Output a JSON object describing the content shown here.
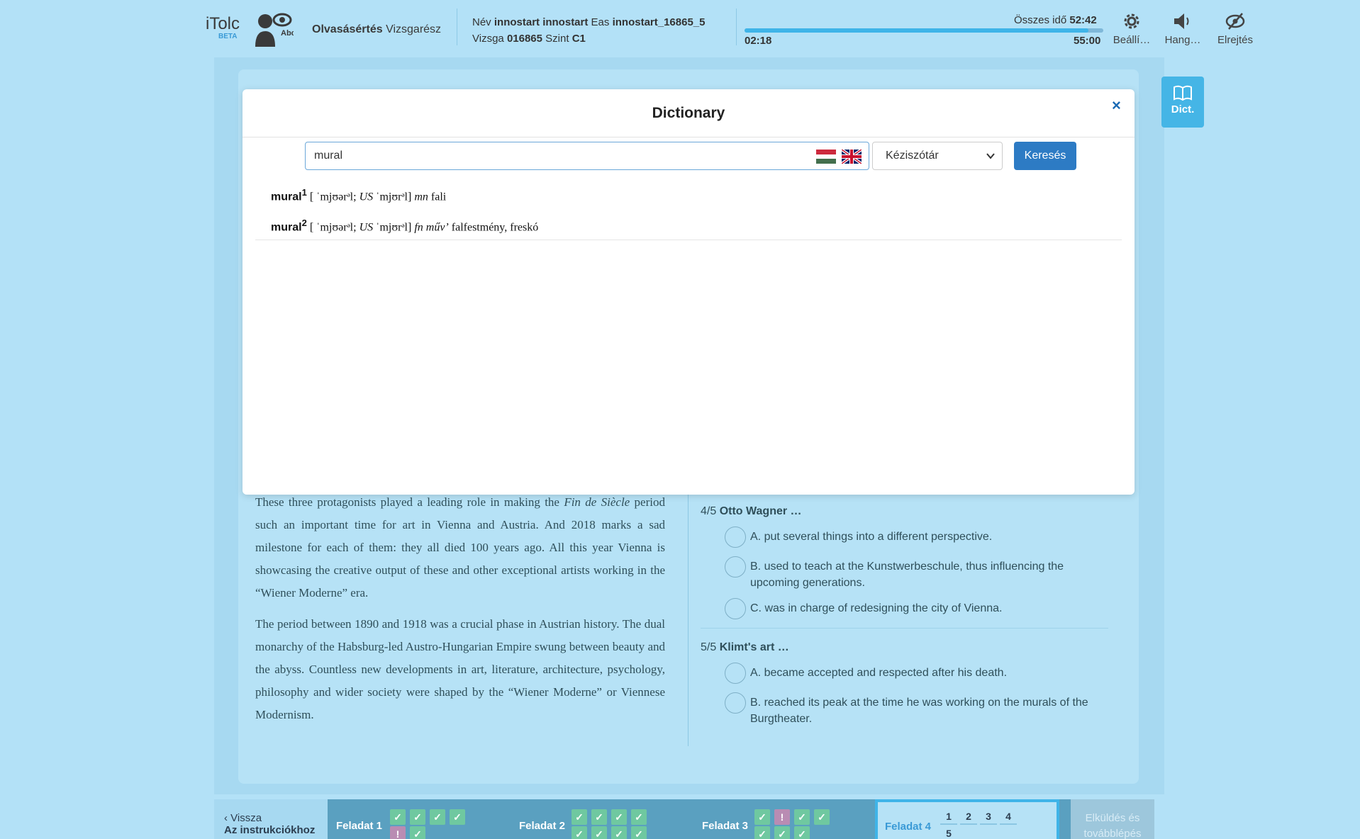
{
  "header": {
    "logo": "iTolc",
    "beta": "BETA",
    "mode_bold": "Olvasásértés",
    "mode_rest": "Vizsgarész",
    "name_label": "Név",
    "name_value": "innostart innostart",
    "eas_label": "Eas",
    "eas_value": "innostart_16865_5",
    "exam_label": "Vizsga",
    "exam_value": "016865",
    "level_label": "Szint",
    "level_value": "C1",
    "total_label": "Összes idő",
    "total_value": "52:42",
    "elapsed": "02:18",
    "remaining": "55:00",
    "progress_fraction": 0.958,
    "settings_label": "Beállí…",
    "sound_label": "Hang…",
    "hide_label": "Elrejtés"
  },
  "sidebar": {
    "dict_label": "Dict."
  },
  "modal": {
    "title": "Dictionary",
    "close": "×",
    "search_value": "mural",
    "dictionary_select": "Kéziszótár",
    "search_button": "Keresés",
    "entries": [
      {
        "headword": "mural",
        "sup": "1",
        "pron": " [ ˈmjʊərᵊl; ",
        "us": "US",
        "pron_us": " ˈmjʊrᵊl] ",
        "pos": "mn",
        "meaning": " fali"
      },
      {
        "headword": "mural",
        "sup": "2",
        "pron": " [ ˈmjʊərᵊl; ",
        "us": "US",
        "pron_us": " ˈmjʊrᵊl] ",
        "pos": "fn művʼ",
        "meaning": " falfestmény, freskó"
      }
    ]
  },
  "passage": {
    "p1_a": "These three protagonists played a leading role in making the ",
    "p1_em": "Fin de Siècle",
    "p1_b": " period such an important time for art in Vienna and Austria. And 2018 marks a sad milestone for each of them: they all died 100 years ago. All this year Vienna is showcasing the creative output of these and other exceptional artists working in the “Wiener Moderne” era.",
    "p2": "The period between 1890 and 1918 was a crucial phase in Austrian history. The dual monarchy of the Habsburg-led Austro-Hungarian Empire swung between beauty and the abyss. Countless new developments in art, literature, architecture, psychology, philosophy and wider society were shaped by the “Wiener Moderne” or Viennese Modernism."
  },
  "questions": [
    {
      "num": "4/5",
      "title": "Otto Wagner …",
      "options": [
        "A. put several things into a different perspective.",
        "B. used to teach at the Kunstwerbeschule, thus influencing the upcoming generations.",
        "C. was in charge of redesigning the city of Vienna."
      ]
    },
    {
      "num": "5/5",
      "title": "Klimt's art …",
      "options": [
        "A. became accepted and respected after his death.",
        "B. reached its peak at the time he was working on the murals of the Burgtheater."
      ]
    }
  ],
  "bottom": {
    "back_line1": "Vissza",
    "back_line2": "Az instrukciókhoz",
    "task1": "Feladat 1",
    "task2": "Feladat 2",
    "task3": "Feladat 3",
    "task4": "Feladat 4",
    "check": "✓",
    "warn": "!",
    "task4_numbers": [
      "1",
      "2",
      "3",
      "4",
      "5"
    ],
    "submit": "Elküldés és továbblépés"
  },
  "colors": {
    "background": "#b3e1f7",
    "accent": "#2d7bc4",
    "check": "#6fc8a0",
    "warn": "#b98cb3"
  }
}
